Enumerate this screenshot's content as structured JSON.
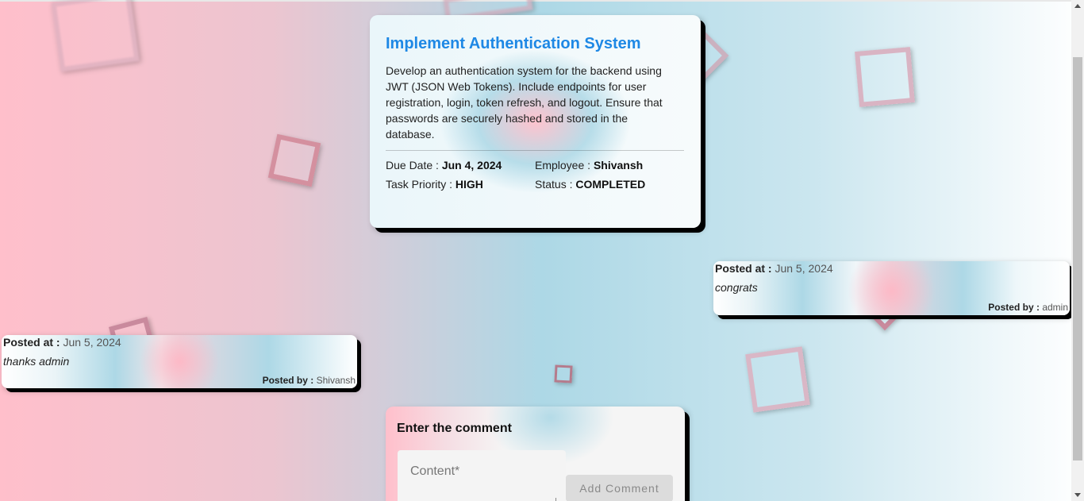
{
  "task": {
    "title": "Implement Authentication System",
    "description": "Develop an authentication system for the backend using JWT (JSON Web Tokens). Include endpoints for user registration, login, token refresh, and logout. Ensure that passwords are securely hashed and stored in the database.",
    "due_date_label": "Due Date :",
    "due_date": "Jun 4, 2024",
    "employee_label": "Employee :",
    "employee": "Shivansh",
    "priority_label": "Task Priority :",
    "priority": "HIGH",
    "status_label": "Status :",
    "status": "COMPLETED"
  },
  "comments": [
    {
      "posted_at_label": "Posted at :",
      "posted_at": "Jun 5, 2024",
      "content": "congrats",
      "posted_by_label": "Posted by :",
      "posted_by": "admin"
    },
    {
      "posted_at_label": "Posted at :",
      "posted_at": "Jun 5, 2024",
      "content": "thanks admin",
      "posted_by_label": "Posted by :",
      "posted_by": "Shivansh"
    }
  ],
  "comment_form": {
    "title": "Enter the comment",
    "content_placeholder": "Content*",
    "submit_label": "Add Comment"
  },
  "colors": {
    "title_blue": "#1e88e5",
    "pink": "#ffbfcb",
    "light_blue": "#add8e6"
  }
}
